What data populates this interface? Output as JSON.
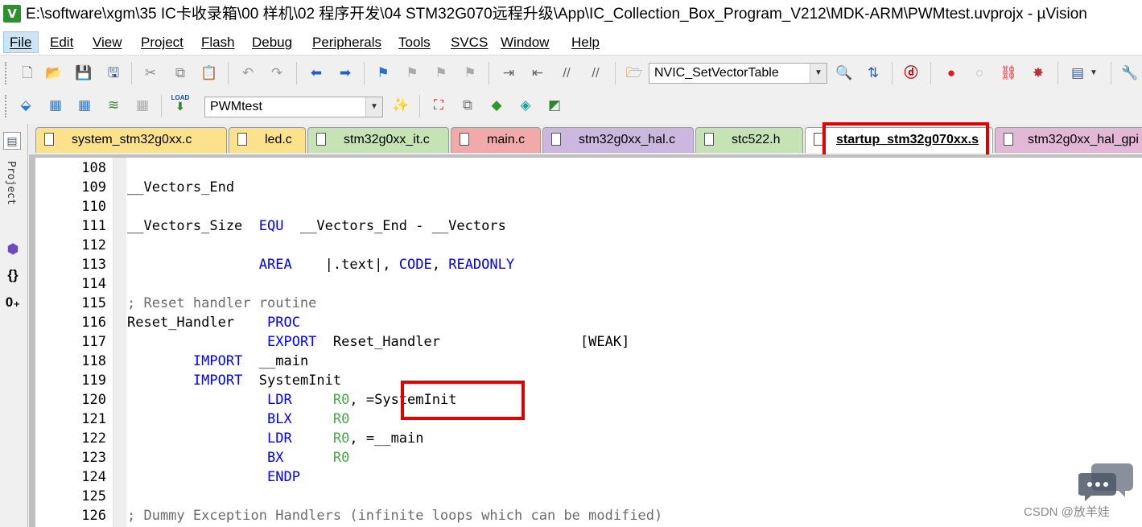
{
  "window": {
    "title": "E:\\software\\xgm\\35 IC卡收录箱\\00 样机\\02 程序开发\\04 STM32G070远程升级\\App\\IC_Collection_Box_Program_V212\\MDK-ARM\\PWMtest.uvprojx - µVision",
    "app_icon": "V"
  },
  "menu": [
    "File",
    "Edit",
    "View",
    "Project",
    "Flash",
    "Debug",
    "Peripherals",
    "Tools",
    "SVCS",
    "Window",
    "Help"
  ],
  "toolbar": {
    "function_combo": "NVIC_SetVectorTable",
    "target_combo": "PWMtest",
    "load_label": "LOAD"
  },
  "sidebar": {
    "project_label": "Project"
  },
  "tabs": [
    {
      "label": "system_stm32g0xx.c",
      "color": "#fce28a"
    },
    {
      "label": "led.c",
      "color": "#fce28a"
    },
    {
      "label": "stm32g0xx_it.c",
      "color": "#c6e3b6"
    },
    {
      "label": "main.c",
      "color": "#f2a9a9"
    },
    {
      "label": "stm32g0xx_hal.c",
      "color": "#cbb7e0"
    },
    {
      "label": "stc522.h",
      "color": "#c6e3b6"
    },
    {
      "label": "startup_stm32g070xx.s",
      "color": "#ffffff",
      "active": true
    },
    {
      "label": "stm32g0xx_hal_gpi",
      "color": "#e3b8d6"
    }
  ],
  "code_lines": [
    {
      "num": "108",
      "parts": []
    },
    {
      "num": "109",
      "parts": [
        {
          "t": "__Vectors_End",
          "c": "tx"
        }
      ]
    },
    {
      "num": "110",
      "parts": []
    },
    {
      "num": "111",
      "parts": [
        {
          "t": "__Vectors_Size  ",
          "c": "tx"
        },
        {
          "t": "EQU",
          "c": "kw"
        },
        {
          "t": "  __Vectors_End - __Vectors",
          "c": "tx"
        }
      ]
    },
    {
      "num": "112",
      "parts": []
    },
    {
      "num": "113",
      "parts": [
        {
          "t": "                ",
          "c": "tx"
        },
        {
          "t": "AREA",
          "c": "kw"
        },
        {
          "t": "    |.text|, ",
          "c": "tx"
        },
        {
          "t": "CODE",
          "c": "kw"
        },
        {
          "t": ", ",
          "c": "tx"
        },
        {
          "t": "READONLY",
          "c": "kw"
        }
      ]
    },
    {
      "num": "114",
      "parts": []
    },
    {
      "num": "115",
      "parts": [
        {
          "t": "; Reset handler routine",
          "c": "cm"
        }
      ]
    },
    {
      "num": "116",
      "parts": [
        {
          "t": "Reset_Handler    ",
          "c": "tx"
        },
        {
          "t": "PROC",
          "c": "kw"
        }
      ]
    },
    {
      "num": "117",
      "parts": [
        {
          "t": "                 ",
          "c": "tx"
        },
        {
          "t": "EXPORT",
          "c": "kw"
        },
        {
          "t": "  Reset_Handler                 [WEAK]",
          "c": "tx"
        }
      ]
    },
    {
      "num": "118",
      "parts": [
        {
          "t": "        ",
          "c": "tx"
        },
        {
          "t": "IMPORT",
          "c": "kw"
        },
        {
          "t": "  __main",
          "c": "tx"
        }
      ]
    },
    {
      "num": "119",
      "parts": [
        {
          "t": "        ",
          "c": "tx"
        },
        {
          "t": "IMPORT",
          "c": "kw"
        },
        {
          "t": "  SystemInit",
          "c": "tx"
        }
      ]
    },
    {
      "num": "120",
      "parts": [
        {
          "t": "                 ",
          "c": "tx"
        },
        {
          "t": "LDR",
          "c": "kw"
        },
        {
          "t": "     ",
          "c": "tx"
        },
        {
          "t": "R0",
          "c": "rg"
        },
        {
          "t": ", =SystemInit",
          "c": "tx"
        }
      ]
    },
    {
      "num": "121",
      "parts": [
        {
          "t": "                 ",
          "c": "tx"
        },
        {
          "t": "BLX",
          "c": "kw"
        },
        {
          "t": "     ",
          "c": "tx"
        },
        {
          "t": "R0",
          "c": "rg"
        }
      ]
    },
    {
      "num": "122",
      "parts": [
        {
          "t": "                 ",
          "c": "tx"
        },
        {
          "t": "LDR",
          "c": "kw"
        },
        {
          "t": "     ",
          "c": "tx"
        },
        {
          "t": "R0",
          "c": "rg"
        },
        {
          "t": ", =__main",
          "c": "tx"
        }
      ]
    },
    {
      "num": "123",
      "parts": [
        {
          "t": "                 ",
          "c": "tx"
        },
        {
          "t": "BX",
          "c": "kw"
        },
        {
          "t": "      ",
          "c": "tx"
        },
        {
          "t": "R0",
          "c": "rg"
        }
      ]
    },
    {
      "num": "124",
      "parts": [
        {
          "t": "                 ",
          "c": "tx"
        },
        {
          "t": "ENDP",
          "c": "kw"
        }
      ]
    },
    {
      "num": "125",
      "parts": []
    },
    {
      "num": "126",
      "parts": [
        {
          "t": "; Dummy Exception Handlers (infinite loops which can be modified)",
          "c": "cm"
        }
      ]
    }
  ],
  "watermark": "CSDN @放羊娃"
}
